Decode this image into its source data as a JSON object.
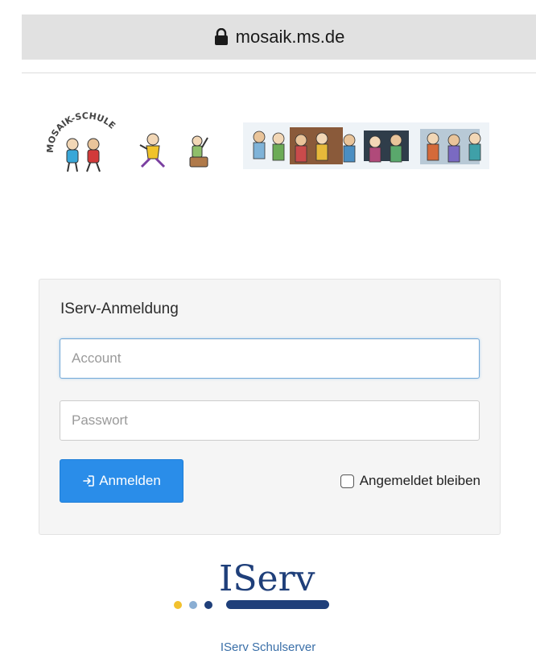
{
  "browser": {
    "url": "mosaik.ms.de"
  },
  "banner": {
    "logo_text": "MOSAIK-SCHULE"
  },
  "login": {
    "title": "IServ-Anmeldung",
    "account_placeholder": "Account",
    "account_value": "",
    "password_placeholder": "Passwort",
    "password_value": "",
    "submit_label": "Anmelden",
    "remember_label": "Angemeldet bleiben",
    "remember_checked": false
  },
  "brand": {
    "logo_text": "IServ",
    "footer_link": "IServ Schulserver"
  },
  "colors": {
    "primary_button": "#2a8de9",
    "brand_navy": "#1f3f7a",
    "brand_yellow": "#f2c12e",
    "brand_lightblue": "#8aaed3"
  }
}
